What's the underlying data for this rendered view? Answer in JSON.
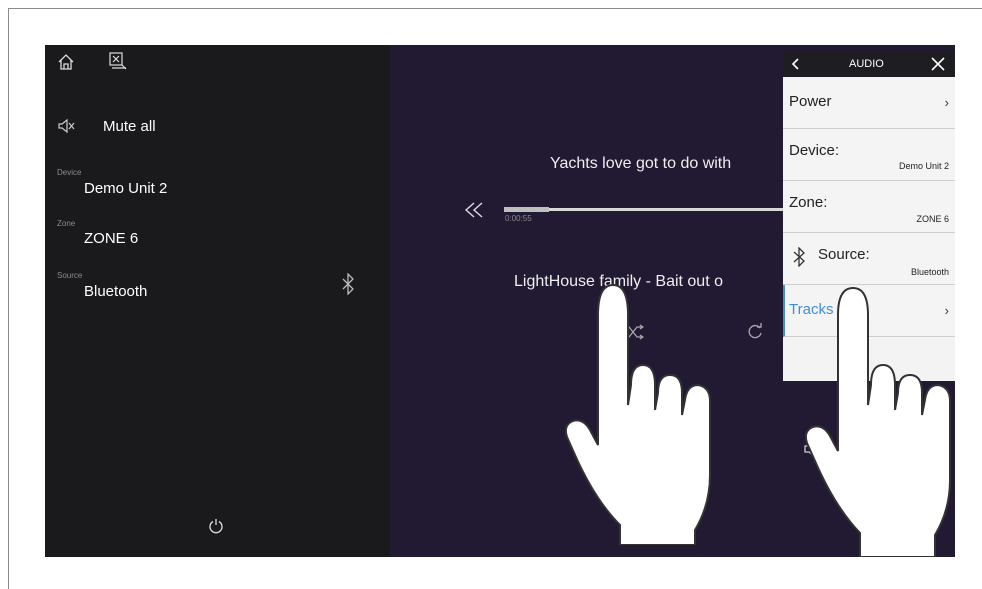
{
  "sidebar": {
    "mute_label": "Mute all",
    "device_caption": "Device",
    "device_value": "Demo Unit 2",
    "zone_caption": "Zone",
    "zone_value": "ZONE 6",
    "source_caption": "Source",
    "source_value": "Bluetooth"
  },
  "player": {
    "song_title": "Yachts love got to do with",
    "elapsed": "0:00:55",
    "artist_album": "LightHouse family - Bait out o"
  },
  "menu": {
    "header_title": "AUDIO",
    "items": [
      {
        "label": "Power",
        "value": ""
      },
      {
        "label": "Device:",
        "value": "Demo Unit 2"
      },
      {
        "label": "Zone:",
        "value": "ZONE 6"
      },
      {
        "label": "Source:",
        "value": "Bluetooth"
      },
      {
        "label": "Tracks",
        "value": ""
      }
    ]
  },
  "colors": {
    "accent_blue": "#3f8fd8",
    "left_panel_bg": "#1a1a1d",
    "main_bg": "#221a33",
    "menu_bg": "#f3f3f3"
  },
  "icons": [
    "home-icon",
    "screen-off-icon",
    "mute-icon",
    "bluetooth-icon",
    "power-icon",
    "skip-back-icon",
    "shuffle-icon",
    "repeat-icon",
    "volume-down-icon",
    "volume-up-icon",
    "back-chevron-icon",
    "close-icon"
  ]
}
